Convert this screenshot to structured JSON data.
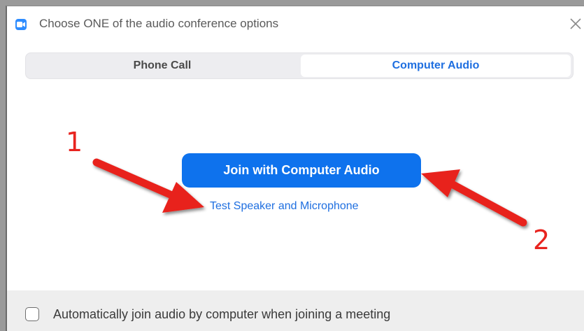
{
  "window": {
    "title": "Choose ONE of the audio conference options",
    "app_icon": "zoom-camera-icon",
    "close_icon": "close-icon"
  },
  "tabs": [
    {
      "label": "Phone Call",
      "selected": false
    },
    {
      "label": "Computer Audio",
      "selected": true
    }
  ],
  "main": {
    "join_button_label": "Join with Computer Audio",
    "test_link_label": "Test Speaker and Microphone"
  },
  "footer": {
    "auto_join_label": "Automatically join audio by computer when joining a meeting",
    "auto_join_checked": false
  },
  "annotations": {
    "marker_1": "1",
    "marker_2": "2",
    "arrow_color": "#e8241f"
  },
  "colors": {
    "accent": "#0e72ed",
    "link": "#1f6fe0"
  }
}
